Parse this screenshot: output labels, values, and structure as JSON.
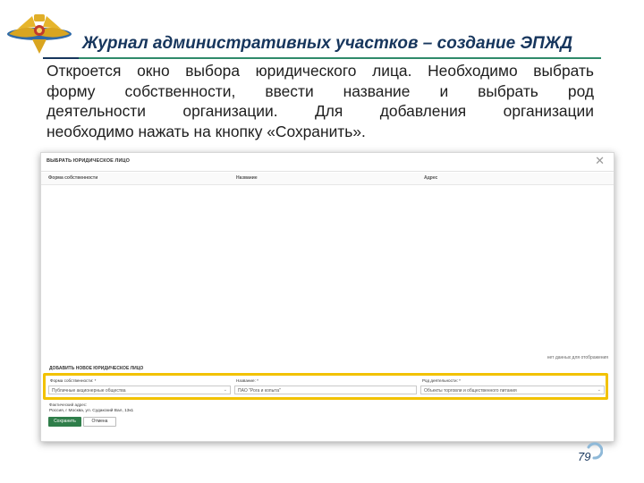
{
  "header": {
    "title": "Журнал административных участков – создание ЭПЖД",
    "logo_icon": "double-headed-eagle-emblem-icon"
  },
  "intro": {
    "lines": [
      "Откроется окно выбора юридического лица. Необходимо выбрать",
      "форму собственности, ввести название и выбрать род",
      "деятельности организации.   Для добавления организации",
      "необходимо нажать на кнопку «Сохранить»."
    ]
  },
  "modal": {
    "title": "ВЫБРАТЬ ЮРИДИЧЕСКОЕ ЛИЦО",
    "close_icon": "close-icon",
    "columns": [
      "Форма собственности",
      "Название",
      "Адрес"
    ],
    "empty_text": "нет данных для отображения",
    "add_section_title": "ДОБАВИТЬ НОВОЕ ЮРИДИЧЕСКОЕ ЛИЦО",
    "fields": {
      "ownership": {
        "label": "Форма собственности: *",
        "value": "Публичные акционерные общества"
      },
      "name": {
        "label": "Название: *",
        "value": "ПАО \"Рога и копыта\""
      },
      "activity": {
        "label": "Род деятельности: *",
        "value": "Объекты торговли и общественного питания"
      }
    },
    "address_label": "Фактический адрес:",
    "address_value": "Россия, г Москва, ул. Судакский Вал, 13к1",
    "save_label": "Сохранить",
    "cancel_label": "Отмена"
  },
  "footer": {
    "page_number": "79"
  },
  "colors": {
    "title": "#17365d",
    "rule": "#2f8a6a",
    "highlight": "#f2c200",
    "save_button": "#2f7e4a"
  }
}
